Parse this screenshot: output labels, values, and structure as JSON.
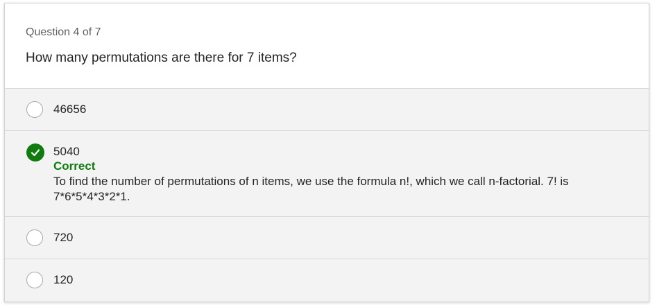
{
  "quiz": {
    "counter": "Question 4 of 7",
    "question": "How many permutations are there for 7 items?",
    "options": [
      {
        "label": "46656",
        "state": "unselected"
      },
      {
        "label": "5040",
        "state": "correct",
        "feedback": "Correct",
        "explanation": "To find the number of permutations of n items, we use the formula n!, which we call n-factorial. 7! is 7*6*5*4*3*2*1."
      },
      {
        "label": "720",
        "state": "unselected"
      },
      {
        "label": "120",
        "state": "unselected"
      }
    ]
  },
  "colors": {
    "correct": "#107c10",
    "option_background": "#f3f3f3",
    "divider": "#d6d6d6"
  },
  "icons": {
    "correct": "checkmark-circle-icon",
    "unselected": "radio-empty-icon"
  }
}
